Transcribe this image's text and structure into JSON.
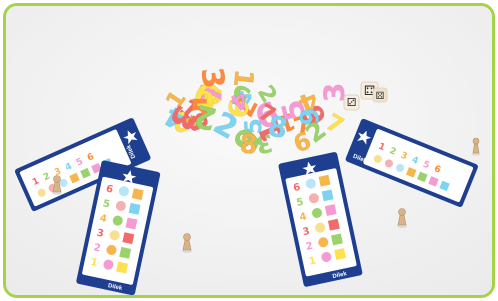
{
  "image": {
    "kind": "product-photo",
    "colors": {
      "frame_border": "#a6d24a",
      "background": "#f3f3f3",
      "card_navy": "#1e3f8f",
      "card_white": "#ffffff",
      "shadow": "#dddddd"
    }
  },
  "cards": [
    {
      "brand": "Dilek",
      "numbers": [
        "6",
        "5",
        "4",
        "3",
        "2",
        "1"
      ]
    },
    {
      "brand": "Dilek",
      "numbers": [
        "6",
        "5",
        "4",
        "3",
        "2",
        "1"
      ]
    },
    {
      "brand": "Dilek",
      "numbers": [
        "6",
        "5",
        "4",
        "3",
        "2",
        "1"
      ]
    },
    {
      "brand": "Dilek",
      "numbers": [
        "6",
        "5",
        "4",
        "3",
        "2",
        "1"
      ]
    }
  ],
  "dice": {
    "visible_faces": [
      "⚃",
      "⚂",
      "⚄"
    ]
  },
  "pieces": {
    "colors": [
      "#f26b6b",
      "#f7b64c",
      "#ffe14d",
      "#7dd3f0",
      "#9ad36b",
      "#f59ad3",
      "#ff8a3d"
    ],
    "digits": [
      "1",
      "2",
      "3",
      "4",
      "5",
      "6",
      "7",
      "8",
      "9",
      "5",
      "2",
      "3",
      "7",
      "1",
      "6",
      "4",
      "2",
      "5",
      "9",
      "3",
      "7",
      "1",
      "8",
      "6",
      "4",
      "2",
      "5",
      "3",
      "7",
      "1",
      "9",
      "6",
      "2",
      "4",
      "5",
      "3",
      "1",
      "7",
      "8",
      "2"
    ]
  }
}
